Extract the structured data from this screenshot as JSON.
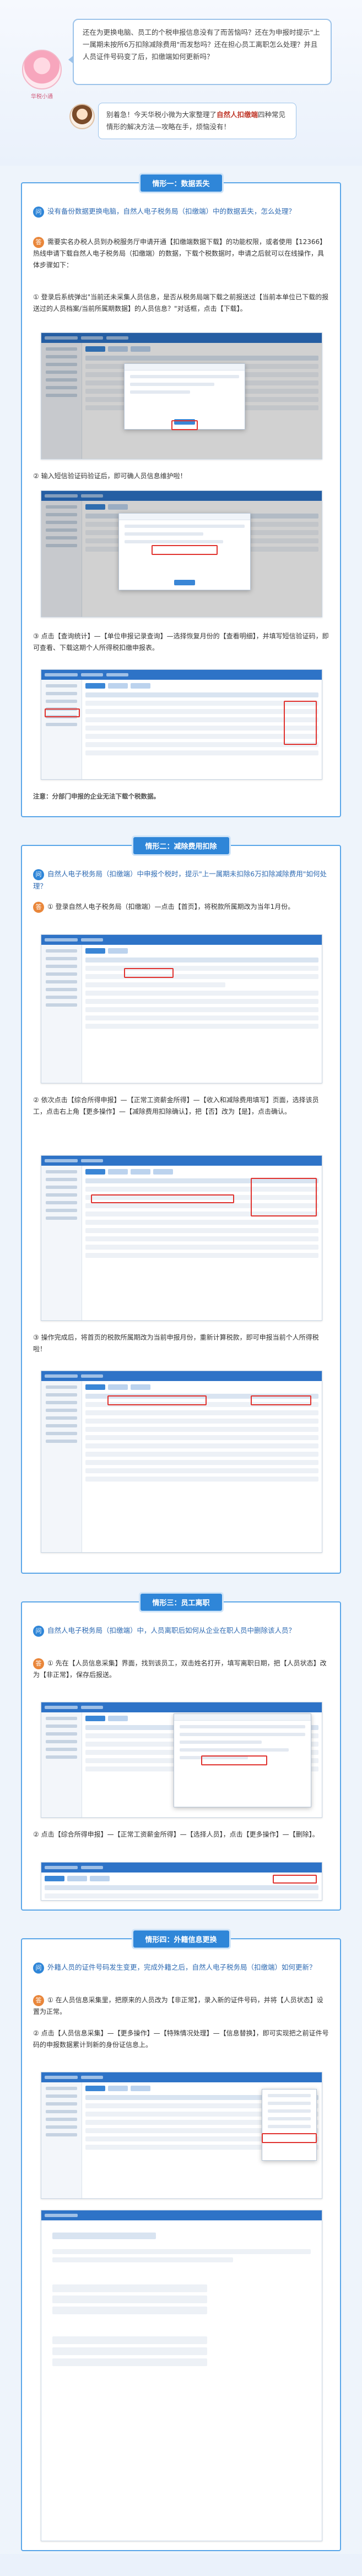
{
  "intro": {
    "question": "还在为更换电脑、员工的个税申报信息没有了而苦恼吗？还在为申报时提示\"上一属期未按所6万扣除减除费用\"而发愁吗？还在担心员工离职怎么处理？并且人员证件号码变了后，扣缴端如何更新吗？",
    "avatar_label": "华税小通",
    "reply_prefix": "别着急！今天华税小微为大家整理了",
    "reply_highlight": "自然人扣缴端",
    "reply_suffix": "四种常见情形的解决方法—攻略在手，烦恼没有！"
  },
  "sections": [
    {
      "title": "情形一：数据丢失",
      "question": "没有备份数据更换电脑，自然人电子税务局（扣缴端）中的数据丢失，怎么处理？",
      "answer_intro": "需要实名办税人员到办税服务厅申请开通【扣缴端数据下载】的功能权限，或者使用【12366】热线申请下载自然人电子税务局（扣缴端）的数据，下载个税数据时，申请之后就可以在线操作，具体步骤如下：",
      "step1": "① 登录后系统弹出\"当前还未采集人员信息，是否从税务局端下载之前报送过【当前本单位已下载的报送过的人员档案/当前所属期数据】的人员信息？\"对话框，点击【下载】。",
      "step2": "② 输入短信验证码验证后，即可确人员信息维护啦！",
      "step3": "③ 点击【查询统计】—【单位申报记录查询】—选择恢复月份的【查看明细】，并填写短信验证码，即可查看、下载这期个人所得税扣缴申报表。",
      "note": "注意：分部门申报的企业无法下载个税数据。"
    },
    {
      "title": "情形二：减除费用扣除",
      "question": "自然人电子税务局（扣缴端）中申报个税时，提示\"上一属期未扣除6万扣除减除费用\"如何处理？",
      "step1": "① 登录自然人电子税务局（扣缴端）—点击【首页】，将税款所属期改为当年1月份。",
      "step2": "② 依次点击【综合所得申报】—【正常工资薪金所得】—【收入和减除费用填写】页面，选择该员工，点击右上角【更多操作】—【减除费用扣除确认】，把【否】改为【是】，点击确认。",
      "step3": "③ 操作完成后，将首页的税款所属期改为当前申报月份，重新计算税款，即可申报当前个人所得税啦！"
    },
    {
      "title": "情形三：员工离职",
      "question": "自然人电子税务局（扣缴端）中，人员离职后如何从企业在职人员中删除该人员？",
      "step1": "① 先在【人员信息采集】界面，找到该员工，双击姓名打开，填写离职日期，把【人员状态】改为【非正常】，保存后报送。",
      "step2": "② 点击【综合所得申报】—【正常工资薪金所得】—【选择人员】，点击【更多操作】—【删除】。"
    },
    {
      "title": "情形四：外籍信息更换",
      "question": "外籍人员的证件号码发生变更，完成外籍之后，自然人电子税务局（扣缴端）如何更新？",
      "step1": "① 在人员信息采集里，把原来的人员改为【非正常】，录入新的证件号码，并将【人员状态】设置为正常。",
      "step2": "② 点击【人员信息采集】—【更多操作】—【特殊情况处理】—【信息替换】，即可实现把之前证件号码的申报数据累计到新的身份证信息上。"
    }
  ],
  "icons": {
    "question": "question-icon",
    "answer": "answer-icon"
  },
  "colors": {
    "accent": "#2f86d8",
    "highlight": "#c0392b",
    "answer_badge": "#e9863a",
    "section_border": "#5aa6e8"
  }
}
